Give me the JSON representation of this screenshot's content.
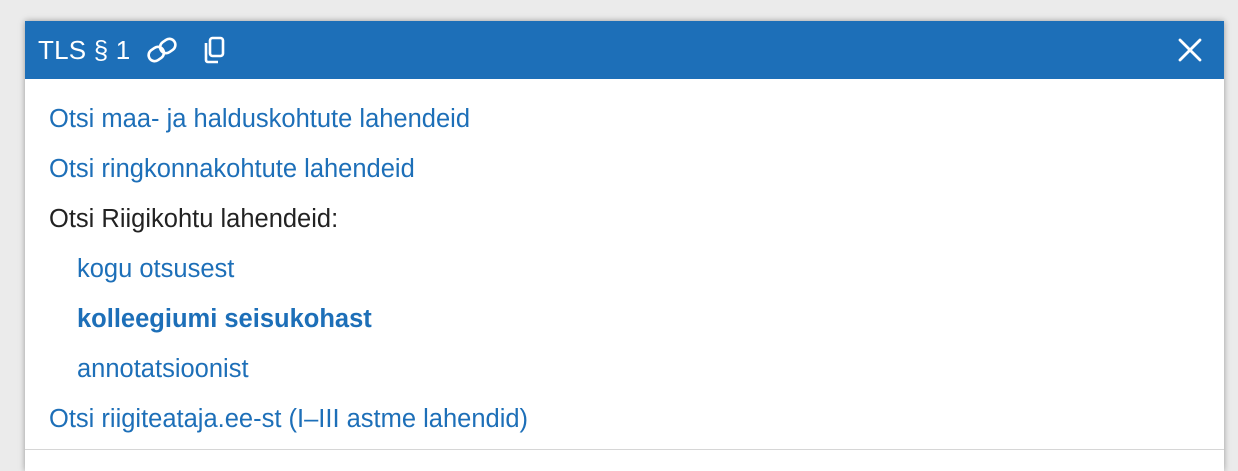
{
  "header": {
    "title": "TLS § 1",
    "link_icon": "link-icon",
    "copy_icon": "copy-icon",
    "close_icon": "close-icon",
    "background_color": "#1d6fb8"
  },
  "menu": {
    "admin_courts": "Otsi maa- ja halduskohtute lahendeid",
    "circuit_courts": "Otsi ringkonnakohtute lahendeid",
    "supreme_court_label": "Otsi Riigikohtu lahendeid:",
    "supreme_whole": "kogu otsusest",
    "supreme_panel_position": "kolleegiumi seisukohast",
    "supreme_annotation": "annotatsioonist",
    "riigiteataja": "Otsi riigiteataja.ee-st (I–III astme lahendid)"
  },
  "colors": {
    "link": "#1d6fb8",
    "text": "#222222"
  }
}
